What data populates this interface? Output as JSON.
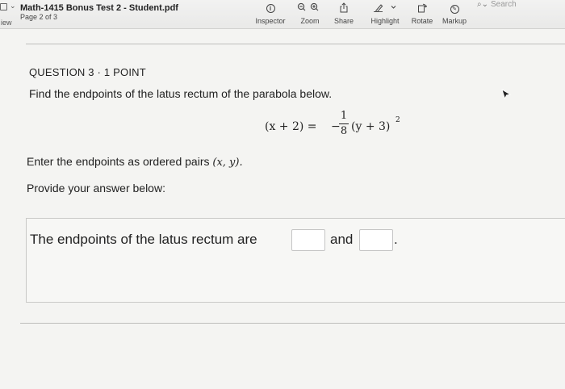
{
  "toolbar": {
    "view_label": "iew",
    "doc_title": "Math-1415 Bonus Test 2 - Student.pdf",
    "page_info": "Page 2 of 3",
    "inspector_label": "Inspector",
    "zoom_label": "Zoom",
    "share_label": "Share",
    "highlight_label": "Highlight",
    "rotate_label": "Rotate",
    "markup_label": "Markup",
    "search_placeholder": "Search"
  },
  "question": {
    "header": "QUESTION 3 · 1 POINT",
    "prompt": "Find the endpoints of the latus rectum of the parabola below.",
    "equation": {
      "lhs": "(x + 2) =",
      "sign": "−",
      "numerator": "1",
      "denominator": "8",
      "rhs": "(y + 3)",
      "exponent": "2"
    },
    "enter_text": "Enter the endpoints as ordered pairs ",
    "enter_math": "(x, y).",
    "provide_text": "Provide your answer below:",
    "answer_prefix": "The endpoints of the latus rectum are",
    "answer_and": "and",
    "answer_suffix": "."
  },
  "icons": {
    "sidebar": "sidebar-icon",
    "inspector": "info-circle-icon",
    "zoom_out": "zoom-out-icon",
    "zoom_in": "zoom-in-icon",
    "share": "share-icon",
    "highlight": "pen-icon",
    "rotate": "rotate-icon",
    "markup": "markup-icon",
    "search": "search-icon"
  }
}
